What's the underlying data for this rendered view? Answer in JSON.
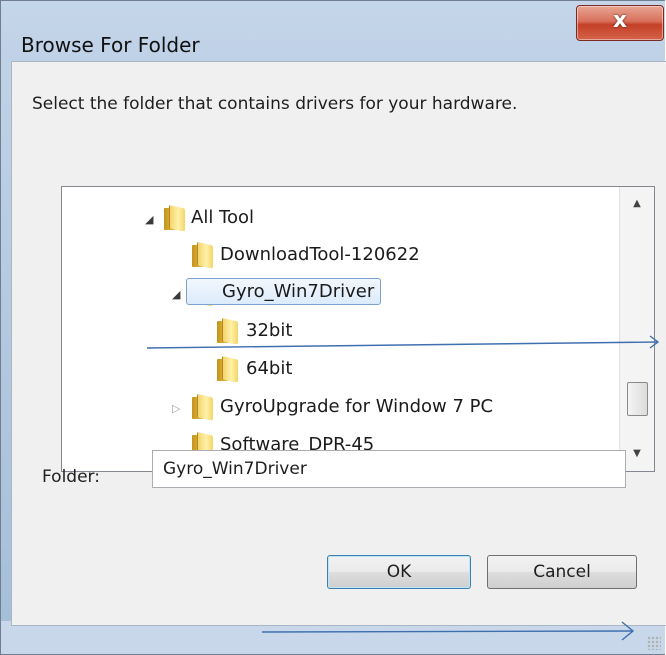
{
  "window": {
    "title": "Browse For Folder",
    "close_glyph": "x"
  },
  "instruction": "Select the folder that contains drivers for your hardware.",
  "tree": {
    "items": [
      {
        "label": "All Tool",
        "level": 0,
        "expander": "expanded",
        "selected": false
      },
      {
        "label": "DownloadTool-120622",
        "level": 1,
        "expander": "none",
        "selected": false
      },
      {
        "label": "Gyro_Win7Driver",
        "level": 1,
        "expander": "expanded",
        "selected": true
      },
      {
        "label": "32bit",
        "level": 2,
        "expander": "none",
        "selected": false
      },
      {
        "label": "64bit",
        "level": 2,
        "expander": "none",
        "selected": false
      },
      {
        "label": "GyroUpgrade for Window 7 PC",
        "level": 1,
        "expander": "collapsed",
        "selected": false
      },
      {
        "label": "Software_DPR-45",
        "level": 1,
        "expander": "none",
        "selected": false
      }
    ],
    "expanded_glyph": "◢",
    "collapsed_glyph": "▷",
    "scroll_up_glyph": "▲",
    "scroll_down_glyph": "▼"
  },
  "folder": {
    "caption": "Folder:",
    "value": "Gyro_Win7Driver"
  },
  "buttons": {
    "ok": "OK",
    "cancel": "Cancel"
  },
  "colors": {
    "annotation_line": "#3f6faf",
    "selection_border": "#7da2ce",
    "close_button": "#c44026"
  }
}
